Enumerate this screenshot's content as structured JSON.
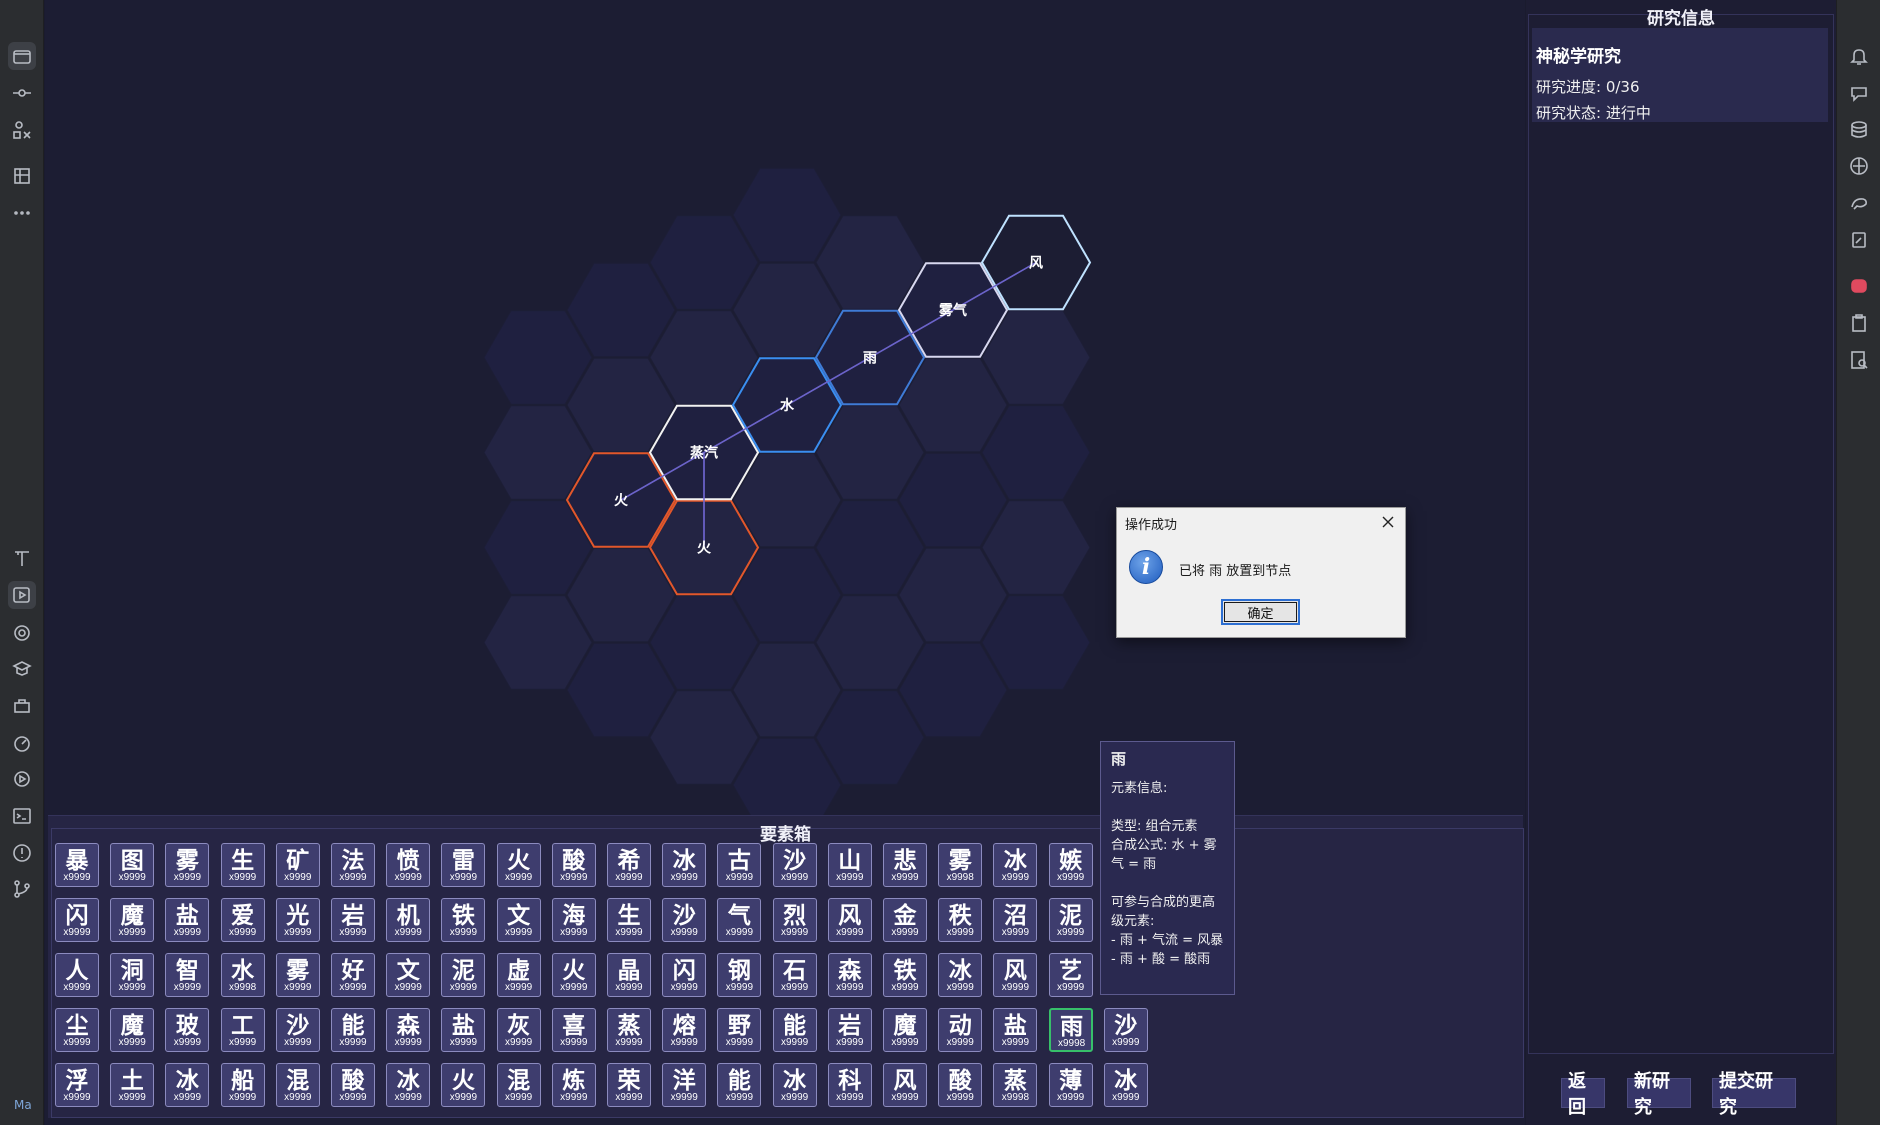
{
  "colors": {
    "hex_empty": "#232443",
    "hex_empty_dark": "#1f2040",
    "fire_stroke": "#e2572b",
    "steam_stroke": "#f2f2f2",
    "water_stroke": "#3a8ef0",
    "rain_stroke": "#3f7bd6",
    "mist_stroke": "#d8d8f0",
    "wind_stroke": "#bfe2ff",
    "link_line": "#6b63c9"
  },
  "board": {
    "nodes": [
      {
        "label": "火",
        "kind": "fire"
      },
      {
        "label": "火",
        "kind": "fire"
      },
      {
        "label": "蒸汽",
        "kind": "steam"
      },
      {
        "label": "水",
        "kind": "water"
      },
      {
        "label": "雨",
        "kind": "rain"
      },
      {
        "label": "雾气",
        "kind": "mist"
      },
      {
        "label": "风",
        "kind": "wind"
      }
    ]
  },
  "dialog": {
    "title": "操作成功",
    "message": "已将 雨 放置到节点",
    "ok_label": "确定",
    "icon": "info-icon"
  },
  "element_box": {
    "title": "要素箱",
    "rows": [
      [
        [
          "暴",
          "x9999"
        ],
        [
          "图",
          "x9999"
        ],
        [
          "雾",
          "x9999"
        ],
        [
          "生",
          "x9999"
        ],
        [
          "矿",
          "x9999"
        ],
        [
          "法",
          "x9999"
        ],
        [
          "愤",
          "x9999"
        ],
        [
          "雷",
          "x9999"
        ],
        [
          "火",
          "x9999"
        ],
        [
          "酸",
          "x9999"
        ],
        [
          "希",
          "x9999"
        ],
        [
          "冰",
          "x9999"
        ],
        [
          "古",
          "x9999"
        ],
        [
          "沙",
          "x9999"
        ],
        [
          "山",
          "x9999"
        ],
        [
          "悲",
          "x9999"
        ],
        [
          "雾",
          "x9998"
        ],
        [
          "冰",
          "x9999"
        ],
        [
          "嫉",
          "x9999"
        ]
      ],
      [
        [
          "闪",
          "x9999"
        ],
        [
          "魔",
          "x9999"
        ],
        [
          "盐",
          "x9999"
        ],
        [
          "爱",
          "x9999"
        ],
        [
          "光",
          "x9999"
        ],
        [
          "岩",
          "x9999"
        ],
        [
          "机",
          "x9999"
        ],
        [
          "铁",
          "x9999"
        ],
        [
          "文",
          "x9999"
        ],
        [
          "海",
          "x9999"
        ],
        [
          "生",
          "x9999"
        ],
        [
          "沙",
          "x9999"
        ],
        [
          "气",
          "x9999"
        ],
        [
          "烈",
          "x9999"
        ],
        [
          "风",
          "x9999"
        ],
        [
          "金",
          "x9999"
        ],
        [
          "秩",
          "x9999"
        ],
        [
          "沼",
          "x9999"
        ],
        [
          "泥",
          "x9999"
        ]
      ],
      [
        [
          "人",
          "x9999"
        ],
        [
          "洞",
          "x9999"
        ],
        [
          "智",
          "x9999"
        ],
        [
          "水",
          "x9998"
        ],
        [
          "雾",
          "x9999"
        ],
        [
          "好",
          "x9999"
        ],
        [
          "文",
          "x9999"
        ],
        [
          "泥",
          "x9999"
        ],
        [
          "虚",
          "x9999"
        ],
        [
          "火",
          "x9999"
        ],
        [
          "晶",
          "x9999"
        ],
        [
          "闪",
          "x9999"
        ],
        [
          "钢",
          "x9999"
        ],
        [
          "石",
          "x9999"
        ],
        [
          "森",
          "x9999"
        ],
        [
          "铁",
          "x9999"
        ],
        [
          "冰",
          "x9999"
        ],
        [
          "风",
          "x9999"
        ],
        [
          "艺",
          "x9999"
        ]
      ],
      [
        [
          "尘",
          "x9999"
        ],
        [
          "魔",
          "x9999"
        ],
        [
          "玻",
          "x9999"
        ],
        [
          "工",
          "x9999"
        ],
        [
          "沙",
          "x9999"
        ],
        [
          "能",
          "x9999"
        ],
        [
          "森",
          "x9999"
        ],
        [
          "盐",
          "x9999"
        ],
        [
          "灰",
          "x9999"
        ],
        [
          "喜",
          "x9999"
        ],
        [
          "蒸",
          "x9999"
        ],
        [
          "熔",
          "x9999"
        ],
        [
          "野",
          "x9999"
        ],
        [
          "能",
          "x9999"
        ],
        [
          "岩",
          "x9999"
        ],
        [
          "魔",
          "x9999"
        ],
        [
          "动",
          "x9999"
        ],
        [
          "盐",
          "x9999"
        ],
        [
          "雨",
          "x9998"
        ],
        [
          "沙",
          "x9999"
        ]
      ],
      [
        [
          "浮",
          "x9999"
        ],
        [
          "土",
          "x9999"
        ],
        [
          "冰",
          "x9999"
        ],
        [
          "船",
          "x9999"
        ],
        [
          "混",
          "x9999"
        ],
        [
          "酸",
          "x9999"
        ],
        [
          "冰",
          "x9999"
        ],
        [
          "火",
          "x9999"
        ],
        [
          "混",
          "x9999"
        ],
        [
          "炼",
          "x9999"
        ],
        [
          "荣",
          "x9999"
        ],
        [
          "洋",
          "x9999"
        ],
        [
          "能",
          "x9999"
        ],
        [
          "冰",
          "x9999"
        ],
        [
          "科",
          "x9999"
        ],
        [
          "风",
          "x9999"
        ],
        [
          "酸",
          "x9999"
        ],
        [
          "蒸",
          "x9998"
        ],
        [
          "薄",
          "x9999"
        ],
        [
          "冰",
          "x9999"
        ]
      ]
    ],
    "selected": "雨"
  },
  "tooltip": {
    "title": "雨",
    "lines": [
      "元素信息:",
      "",
      "类型: 组合元素",
      "合成公式: 水 + 雾气 = 雨",
      "",
      "可参与合成的更高级元素:",
      "- 雨 + 气流 = 风暴",
      "- 雨 + 酸 = 酸雨"
    ]
  },
  "info_panel": {
    "title": "研究信息",
    "research_name": "神秘学研究",
    "progress": "研究进度: 0/36",
    "status": "研究状态: 进行中",
    "buttons": {
      "back": "返回",
      "new": "新研究",
      "submit": "提交研究"
    }
  },
  "ide": {
    "left_icons": [
      "project-icon",
      "commit-icon",
      "structure-icon",
      "bookmarks-icon",
      "more-icon",
      "build-icon",
      "run-icon",
      "plugins-icon",
      "learn-icon",
      "services-icon",
      "profiler-icon",
      "debug-icon",
      "terminal-icon",
      "problems-icon",
      "git-icon"
    ],
    "right_icons": [
      "notifications-icon",
      "ai-assistant-icon",
      "database-icon",
      "maven-icon",
      "gradle-icon",
      "endpoints-icon",
      "plugin-badge-icon",
      "clipboard-icon",
      "search-doc-icon"
    ],
    "status_tag": "Ma"
  }
}
